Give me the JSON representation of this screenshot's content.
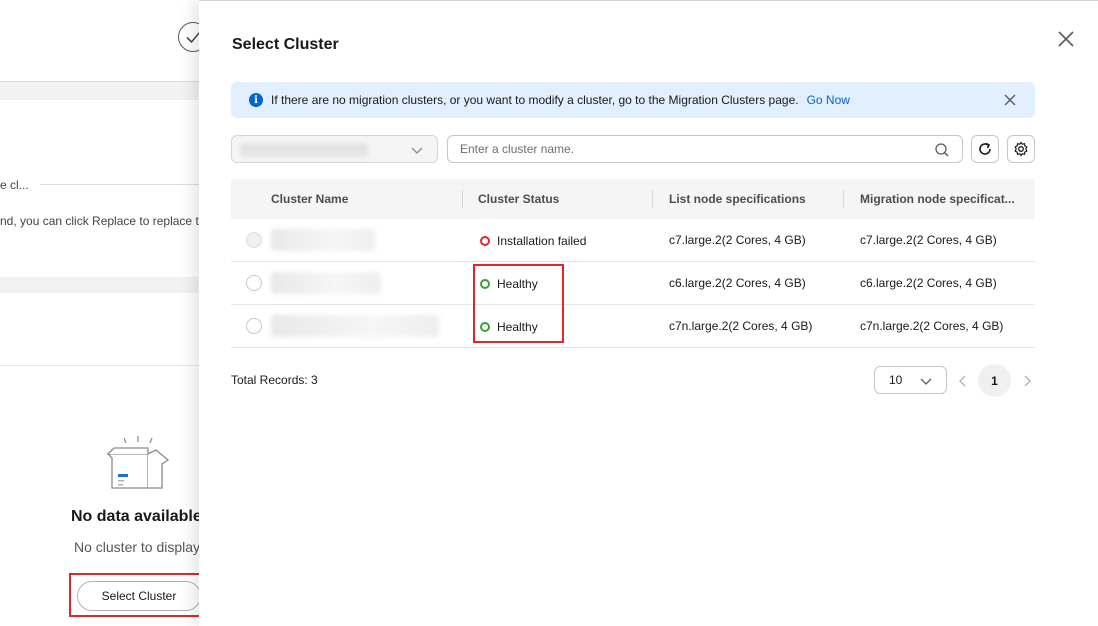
{
  "background": {
    "truncated_text_1": "e cl...",
    "truncated_text_2": "nd, you can click Replace to replace t",
    "empty_title": "No data available",
    "empty_subtitle": "No cluster to display",
    "select_cluster_label": "Select Cluster"
  },
  "drawer": {
    "title": "Select Cluster",
    "notice": {
      "text": "If there are no migration clusters, or you want to modify a cluster, go to the Migration Clusters page.",
      "link": "Go Now"
    },
    "search": {
      "placeholder": "Enter a cluster name."
    },
    "table": {
      "columns": [
        "Cluster Name",
        "Cluster Status",
        "List node specifications",
        "Migration node specificat..."
      ],
      "rows": [
        {
          "status": "Installation failed",
          "status_color": "#e3262a",
          "list_spec": "c7.large.2(2 Cores, 4 GB)",
          "migration_spec": "c7.large.2(2 Cores, 4 GB)",
          "selectable": false
        },
        {
          "status": "Healthy",
          "status_color": "#3ba03a",
          "list_spec": "c6.large.2(2 Cores, 4 GB)",
          "migration_spec": "c6.large.2(2 Cores, 4 GB)",
          "selectable": true
        },
        {
          "status": "Healthy",
          "status_color": "#3ba03a",
          "list_spec": "c7n.large.2(2 Cores, 4 GB)",
          "migration_spec": "c7n.large.2(2 Cores, 4 GB)",
          "selectable": true
        }
      ]
    },
    "footer": {
      "total": "Total Records: 3",
      "page_size": "10",
      "current_page": "1"
    }
  },
  "icons": {
    "close": "close-icon",
    "info": "info-icon",
    "search": "search-icon",
    "refresh": "refresh-icon",
    "settings": "gear-icon",
    "chevron": "chevron-down-icon"
  }
}
